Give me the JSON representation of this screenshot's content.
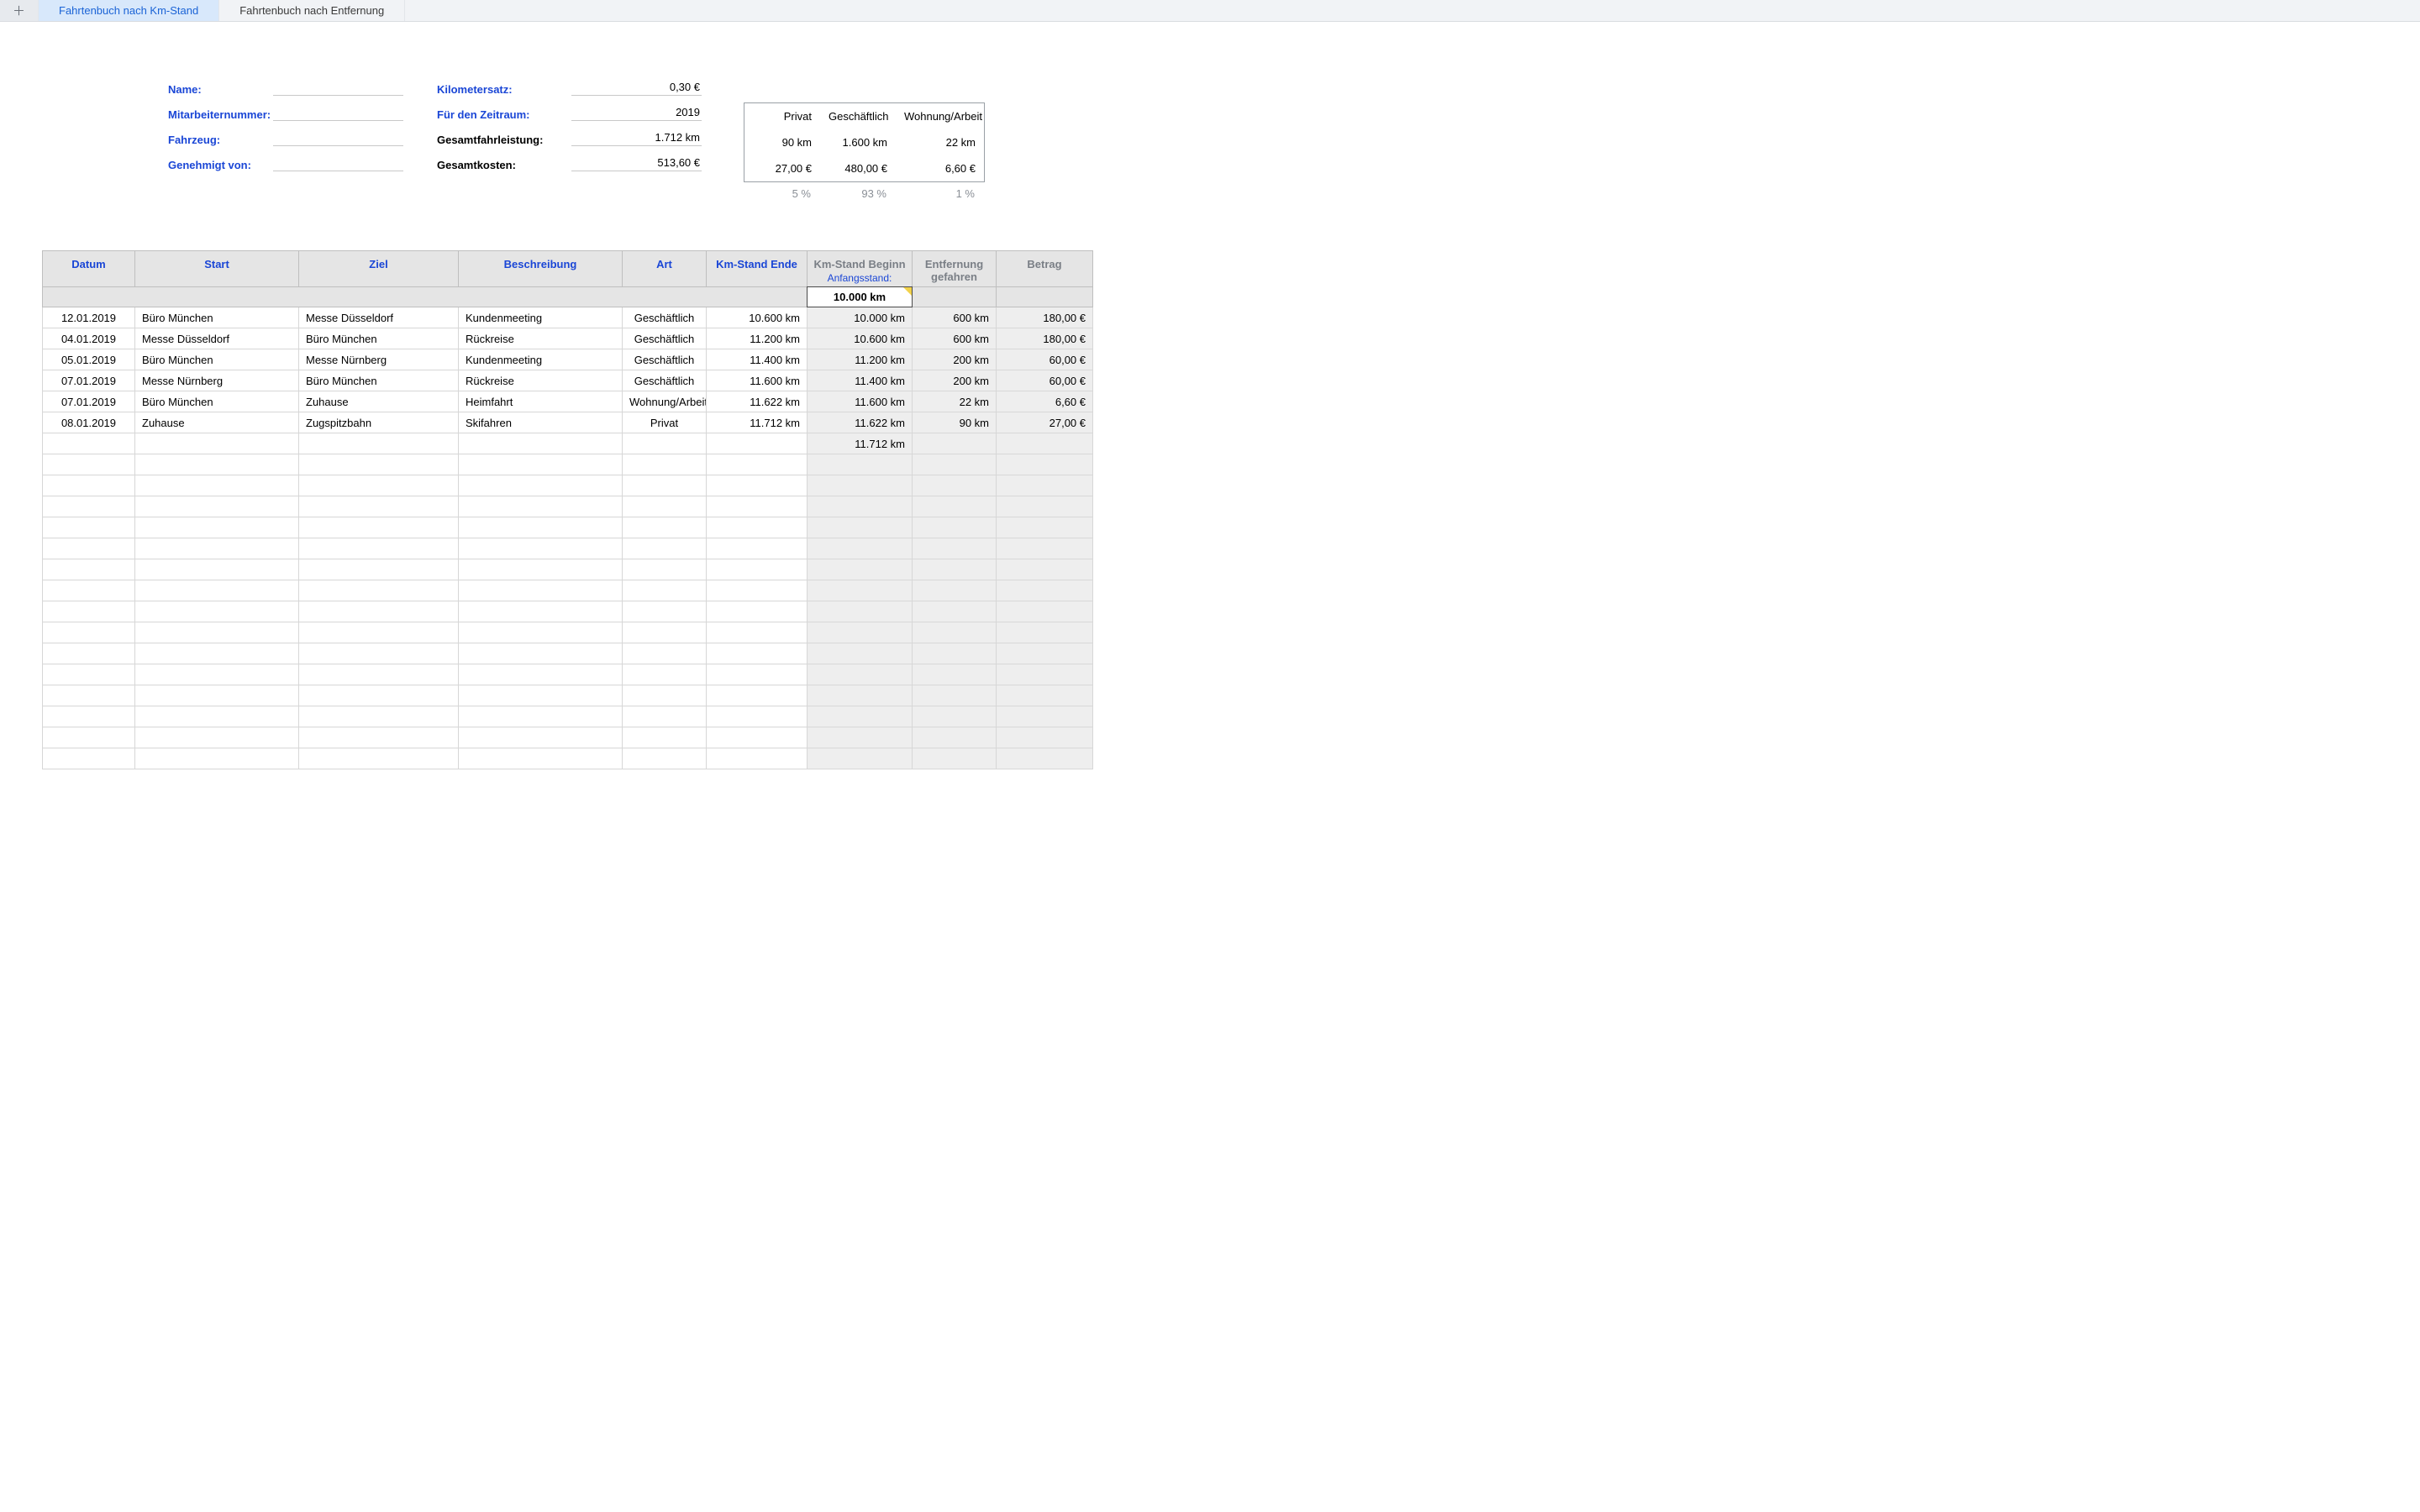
{
  "tabs": {
    "items": [
      {
        "label": "Fahrtenbuch nach Km-Stand",
        "active": true
      },
      {
        "label": "Fahrtenbuch nach Entfernung",
        "active": false
      }
    ]
  },
  "header": {
    "left": {
      "name": {
        "label": "Name:",
        "value": ""
      },
      "empno": {
        "label": "Mitarbeiternummer:",
        "value": ""
      },
      "vehicle": {
        "label": "Fahrzeug:",
        "value": ""
      },
      "approvedby": {
        "label": "Genehmigt von:",
        "value": ""
      }
    },
    "right": {
      "rate": {
        "label": "Kilometersatz:",
        "value": "0,30 €"
      },
      "period": {
        "label": "Für den Zeitraum:",
        "value": "2019"
      },
      "total": {
        "label": "Gesamtfahrleistung:",
        "value": "1.712 km"
      },
      "cost": {
        "label": "Gesamtkosten:",
        "value": "513,60 €"
      }
    },
    "summary": {
      "cols": {
        "private": "Privat",
        "business": "Geschäftlich",
        "commute": "Wohnung/Arbeit"
      },
      "km": {
        "private": "90 km",
        "business": "1.600 km",
        "commute": "22 km"
      },
      "eur": {
        "private": "27,00 €",
        "business": "480,00 €",
        "commute": "6,60 €"
      },
      "pct": {
        "private": "5 %",
        "business": "93 %",
        "commute": "1 %"
      }
    }
  },
  "table": {
    "headers": {
      "datum": "Datum",
      "start": "Start",
      "ziel": "Ziel",
      "beschr": "Beschreibung",
      "art": "Art",
      "ende": "Km-Stand Ende",
      "beginn": "Km-Stand Beginn",
      "beginn_sub": "Anfangsstand:",
      "entf": "Entfernung gefahren",
      "betrag": "Betrag"
    },
    "start_km": "10.000 km",
    "rows": [
      {
        "datum": "12.01.2019",
        "start": "Büro München",
        "ziel": "Messe Düsseldorf",
        "beschr": "Kundenmeeting",
        "art": "Geschäftlich",
        "ende": "10.600 km",
        "beginn": "10.000 km",
        "entf": "600 km",
        "betrag": "180,00 €"
      },
      {
        "datum": "04.01.2019",
        "start": "Messe Düsseldorf",
        "ziel": "Büro München",
        "beschr": "Rückreise",
        "art": "Geschäftlich",
        "ende": "11.200 km",
        "beginn": "10.600 km",
        "entf": "600 km",
        "betrag": "180,00 €"
      },
      {
        "datum": "05.01.2019",
        "start": "Büro München",
        "ziel": "Messe Nürnberg",
        "beschr": "Kundenmeeting",
        "art": "Geschäftlich",
        "ende": "11.400 km",
        "beginn": "11.200 km",
        "entf": "200 km",
        "betrag": "60,00 €"
      },
      {
        "datum": "07.01.2019",
        "start": "Messe Nürnberg",
        "ziel": "Büro München",
        "beschr": "Rückreise",
        "art": "Geschäftlich",
        "ende": "11.600 km",
        "beginn": "11.400 km",
        "entf": "200 km",
        "betrag": "60,00 €"
      },
      {
        "datum": "07.01.2019",
        "start": "Büro München",
        "ziel": "Zuhause",
        "beschr": "Heimfahrt",
        "art": "Wohnung/Arbeit",
        "ende": "11.622 km",
        "beginn": "11.600 km",
        "entf": "22 km",
        "betrag": "6,60 €"
      },
      {
        "datum": "08.01.2019",
        "start": "Zuhause",
        "ziel": "Zugspitzbahn",
        "beschr": "Skifahren",
        "art": "Privat",
        "ende": "11.712 km",
        "beginn": "11.622 km",
        "entf": "90 km",
        "betrag": "27,00 €"
      }
    ],
    "next_beginn": "11.712 km",
    "empty_rows": 15
  }
}
